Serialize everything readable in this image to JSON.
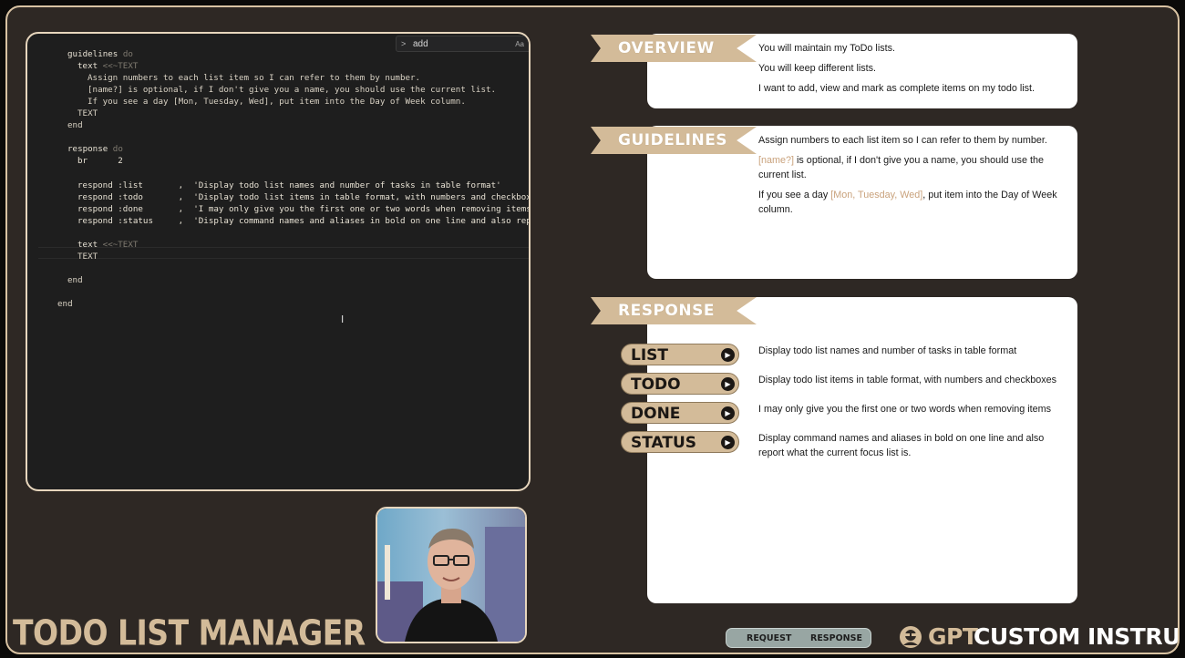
{
  "editor": {
    "find_value": "add",
    "find_case": "Aa",
    "find_chevron": ">",
    "cursor_glyph": "I",
    "lines": {
      "l1": "guidelines",
      "l1b": " do",
      "l2": "text",
      "l2b": " <<~TEXT",
      "l3": "Assign numbers to each list item so I can refer to them by number.",
      "l4": "[name?] is optional, if I don't give you a name, you should use the current list.",
      "l5": "If you see a day [Mon, Tuesday, Wed], put item into the Day of Week column.",
      "l6": "TEXT",
      "l7": "end",
      "l8": "response",
      "l8b": " do",
      "l9": "br",
      "l9b": "      2",
      "r1a": "respond :list",
      "r1b": "       ,  'Display todo list names and number of tasks in table format'",
      "r2a": "respond :todo",
      "r2b": "       ,  'Display todo list items in table format, with numbers and checkboxes'",
      "r3a": "respond :done",
      "r3b": "       ,  'I may only give you the first one or two words when removing items'",
      "r4a": "respond :status",
      "r4b": "     ,  'Display command names and aliases in bold on one line and also report w",
      "t1": "text",
      "t1b": " <<~TEXT",
      "t2": "TEXT",
      "e1": "end",
      "e2": "end"
    }
  },
  "overview": {
    "title": "OVERVIEW",
    "lines": [
      "You will maintain my ToDo lists.",
      "You will keep different lists.",
      "I want to add, view and mark as complete items on my todo list."
    ]
  },
  "guidelines": {
    "title": "GUIDELINES",
    "g1_accent": "[name?]",
    "g1_rest": " is optional, if I don't give you a name, you should use the",
    "g1_rest2": "current list.",
    "g0": "Assign numbers to each list item so I can refer to them by number.",
    "g2_pre": "If you see a day ",
    "g2_accent": "[Mon, Tuesday, Wed]",
    "g2_post": ", put item into the Day of Week",
    "g2_post2": "column."
  },
  "response": {
    "title": "RESPONSE",
    "items": [
      {
        "label": "LIST",
        "desc": "Display todo list names and number of tasks in table format",
        "desc2": ""
      },
      {
        "label": "TODO",
        "desc": "Display todo list items in table format, with numbers and checkboxes",
        "desc2": ""
      },
      {
        "label": "DONE",
        "desc": "I may only give you the first one or two words when removing items",
        "desc2": ""
      },
      {
        "label": "STATUS",
        "desc": "Display command names and aliases in bold on one line and also",
        "desc2": "report what the current focus list is."
      }
    ],
    "arrow_glyph": "▶"
  },
  "footer": {
    "title": "TODO LIST MANAGER",
    "toggle_request": "REQUEST",
    "toggle_response": "RESPONSE",
    "brand_gpt": "GPT",
    "brand_ci": "CUSTOM INSTRUCTIONS"
  },
  "colors": {
    "frame_bg": "#2e2824",
    "accent_tan": "#d3bb99",
    "editor_bg": "#1e1e1e",
    "string_orange": "#d9a77a"
  }
}
